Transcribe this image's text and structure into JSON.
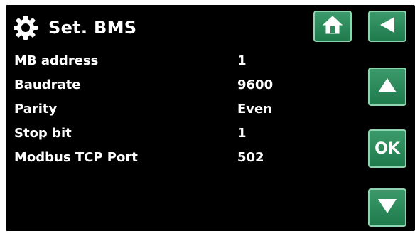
{
  "header": {
    "title": "Set. BMS"
  },
  "icons": {
    "settings": "gear-icon",
    "home": "home-icon",
    "back": "back-arrow-icon",
    "up": "up-arrow-icon",
    "down": "down-arrow-icon"
  },
  "buttons": {
    "ok_label": "OK"
  },
  "settings": [
    {
      "label": "MB address",
      "value": "1"
    },
    {
      "label": "Baudrate",
      "value": "9600"
    },
    {
      "label": "Parity",
      "value": "Even"
    },
    {
      "label": "Stop bit",
      "value": "1"
    },
    {
      "label": "Modbus TCP Port",
      "value": "502"
    }
  ],
  "colors": {
    "background": "#000000",
    "text": "#ffffff",
    "button": "#2a8a5a",
    "button_border": "#8fd4b0"
  }
}
